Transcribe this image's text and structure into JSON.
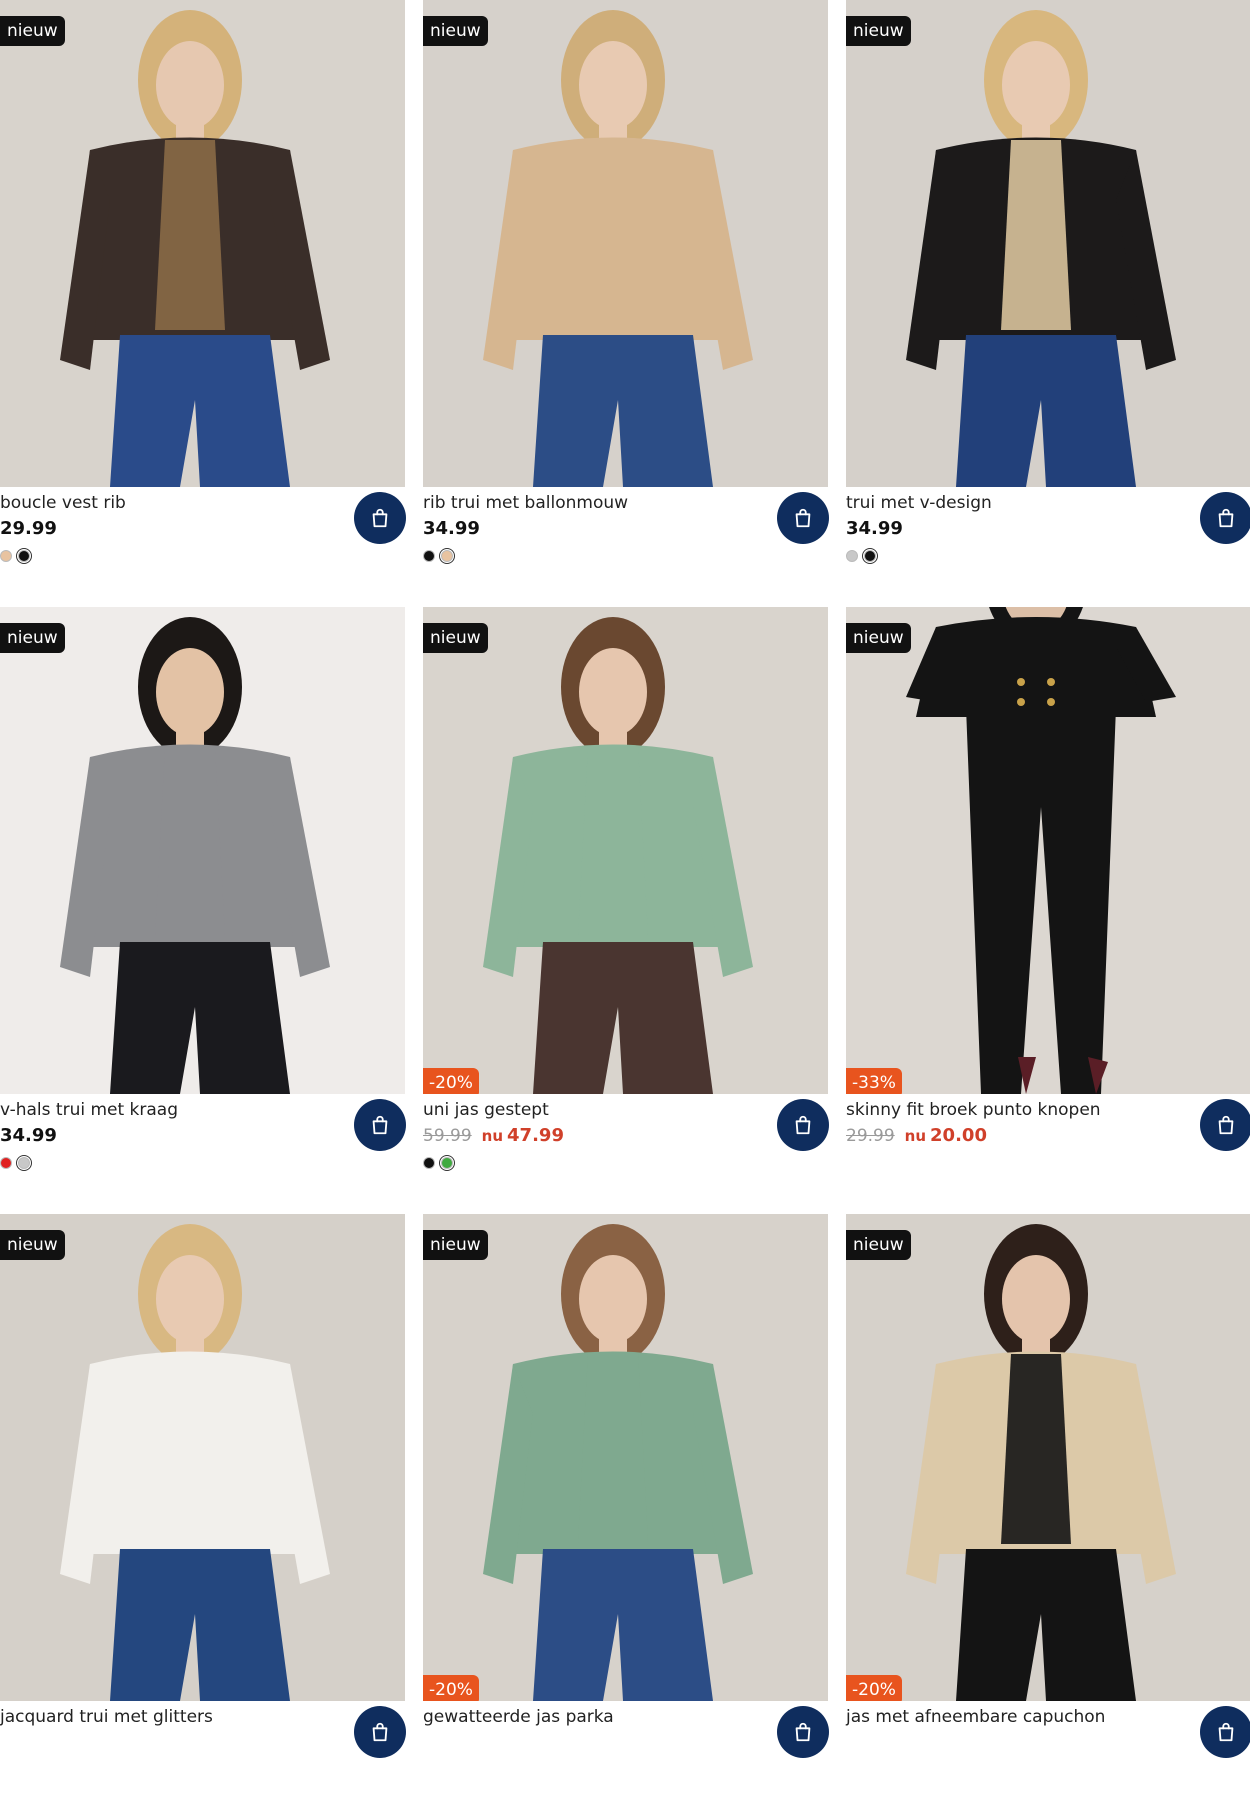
{
  "colors": {
    "badge_new_bg": "#111111",
    "badge_discount_bg": "#e8541e",
    "sale_price": "#d0402a",
    "cart_button": "#0f2d5e"
  },
  "products": [
    {
      "badge": "nieuw",
      "discount": "",
      "title": "boucle vest rib",
      "price": "29.99",
      "old_price": "",
      "now_label": "",
      "now_price": "",
      "swatches": [
        "#e8c3a0",
        "#111111"
      ],
      "selected_swatch": 1,
      "image": {
        "bg": "#d8d3cc",
        "top": "#3a2e29",
        "inner": "#8a6a46",
        "bottom": "#2a4b8a",
        "skin": "#e6c8b0",
        "hair": "#d4b27a"
      }
    },
    {
      "badge": "nieuw",
      "discount": "",
      "title": "rib trui met ballonmouw",
      "price": "34.99",
      "old_price": "",
      "now_label": "",
      "now_price": "",
      "swatches": [
        "#111111",
        "#e8c3a0"
      ],
      "selected_swatch": 1,
      "image": {
        "bg": "#d6d1cb",
        "top": "#d6b690",
        "inner": "#d6b690",
        "bottom": "#2c4d86",
        "skin": "#e8cab2",
        "hair": "#cfae7a"
      }
    },
    {
      "badge": "nieuw",
      "discount": "",
      "title": "trui met v-design",
      "price": "34.99",
      "old_price": "",
      "now_label": "",
      "now_price": "",
      "swatches": [
        "#c8c8c8",
        "#111111"
      ],
      "selected_swatch": 1,
      "image": {
        "bg": "#d5d0ca",
        "top": "#1c1a1a",
        "inner": "#d9c39c",
        "bottom": "#22407a",
        "skin": "#e8cab2",
        "hair": "#d8b77e"
      }
    },
    {
      "badge": "nieuw",
      "discount": "",
      "title": "v-hals trui met kraag",
      "price": "34.99",
      "old_price": "",
      "now_label": "",
      "now_price": "",
      "swatches": [
        "#e02020",
        "#c8c8c8"
      ],
      "selected_swatch": 1,
      "image": {
        "bg": "#efecea",
        "top": "#8c8d90",
        "inner": "#8c8d90",
        "bottom": "#1a1a1e",
        "skin": "#e3c2a5",
        "hair": "#1c1816"
      }
    },
    {
      "badge": "nieuw",
      "discount": "-20%",
      "title": "uni jas gestept",
      "price": "",
      "old_price": "59.99",
      "now_label": "nu",
      "now_price": "47.99",
      "swatches": [
        "#111111",
        "#3faa3f"
      ],
      "selected_swatch": 1,
      "image": {
        "bg": "#d9d4cd",
        "top": "#8db59a",
        "inner": "#8db59a",
        "bottom": "#4a3530",
        "skin": "#e6c6ae",
        "hair": "#6a4830"
      }
    },
    {
      "badge": "nieuw",
      "discount": "-33%",
      "title": "skinny fit broek punto knopen",
      "price": "",
      "old_price": "29.99",
      "now_label": "nu",
      "now_price": "20.00",
      "swatches": [],
      "selected_swatch": -1,
      "image": {
        "bg": "#dcd7d1",
        "top": "#141414",
        "inner": "#141414",
        "bottom": "#141414",
        "skin": "#dcbfa7",
        "hair": "#141414"
      }
    },
    {
      "badge": "nieuw",
      "discount": "",
      "title": "jacquard trui met glitters",
      "price": "",
      "old_price": "",
      "now_label": "",
      "now_price": "",
      "swatches": [],
      "selected_swatch": -1,
      "image": {
        "bg": "#d5d0c9",
        "top": "#f2f0ec",
        "inner": "#f2f0ec",
        "bottom": "#24477f",
        "skin": "#e8cab2",
        "hair": "#d8b882"
      }
    },
    {
      "badge": "nieuw",
      "discount": "-20%",
      "title": "gewatteerde jas parka",
      "price": "",
      "old_price": "",
      "now_label": "",
      "now_price": "",
      "swatches": [],
      "selected_swatch": -1,
      "image": {
        "bg": "#d7d2cb",
        "top": "#7fa98f",
        "inner": "#7fa98f",
        "bottom": "#2c4d86",
        "skin": "#e6c6ae",
        "hair": "#8a6244"
      }
    },
    {
      "badge": "nieuw",
      "discount": "-20%",
      "title": "jas met afneembare capuchon",
      "price": "",
      "old_price": "",
      "now_label": "",
      "now_price": "",
      "swatches": [],
      "selected_swatch": -1,
      "image": {
        "bg": "#d6d1ca",
        "top": "#dcc9a8",
        "inner": "#141414",
        "bottom": "#141414",
        "skin": "#e4c4ac",
        "hair": "#2e201a"
      }
    }
  ]
}
